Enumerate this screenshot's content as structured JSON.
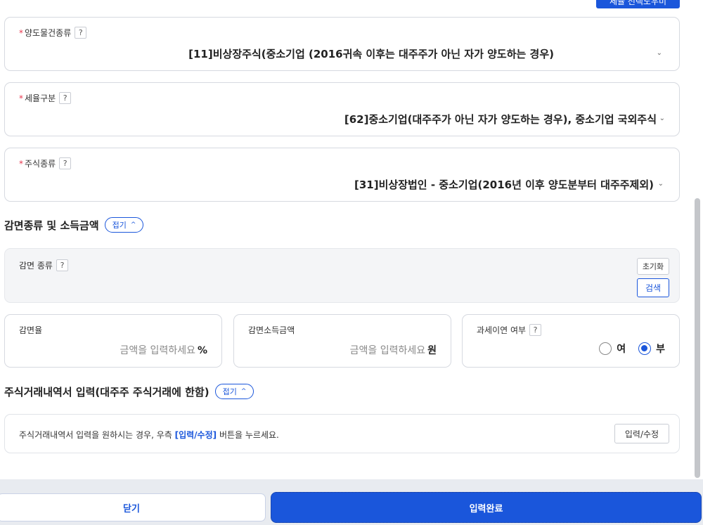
{
  "top_button": "세율 선택도우미",
  "question_mark": "?",
  "required_mark": "*",
  "transfer_type": {
    "label": "양도물건종류",
    "value": "[11]비상장주식(중소기업 (2016귀속 이후는 대주주가 아닌 자가 양도하는 경우)"
  },
  "tax_rate_class": {
    "label": "세율구분",
    "value": "[62]중소기업(대주주가 아닌 자가 양도하는 경우), 중소기업 국외주식"
  },
  "stock_type": {
    "label": "주식종류",
    "value": "[31]비상장법인 - 중소기업(2016년 이후 양도분부터 대주주제외)"
  },
  "exemption_section": {
    "title": "감면종류 및 소득금액",
    "toggle_label": "접기",
    "type_label": "감면 종류",
    "reset_button": "초기화",
    "search_button": "검색",
    "rate_label": "감면율",
    "rate_placeholder": "금액을 입력하세요",
    "rate_unit": "%",
    "income_label": "감면소득금액",
    "income_placeholder": "금액을 입력하세요",
    "income_unit": "원",
    "deferred_label": "과세이연 여부",
    "option_yes": "여",
    "option_no": "부",
    "selected": "부"
  },
  "trade_section": {
    "title": "주식거래내역서 입력(대주주 주식거래에 한함)",
    "toggle_label": "접기",
    "info_prefix": "주식거래내역서 입력을 원하시는 경우, 우측 ",
    "info_highlight": "[입력/수정]",
    "info_suffix": " 버튼을 누르세요.",
    "edit_button": "입력/수정"
  },
  "footer": {
    "close_button": "닫기",
    "submit_button": "입력완료"
  },
  "colors": {
    "accent": "#1a56db",
    "required": "#e8384f"
  }
}
